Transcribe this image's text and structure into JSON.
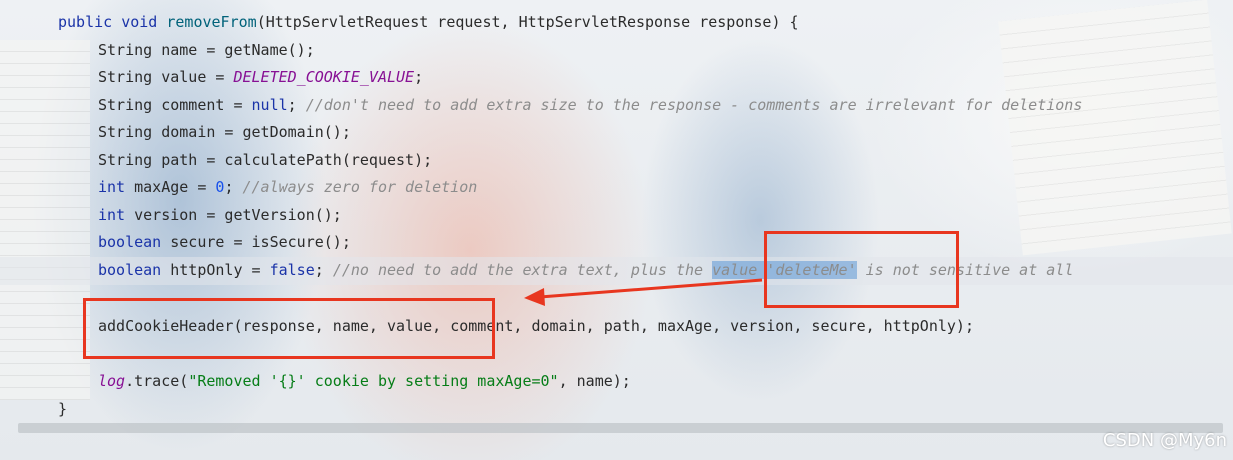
{
  "code": {
    "line1": {
      "kw1": "public",
      "kw2": "void",
      "method": "removeFrom",
      "rest": "(HttpServletRequest request, HttpServletResponse response) {"
    },
    "line2": {
      "text": "String name = getName();"
    },
    "line3": {
      "pre": "String value = ",
      "const": "DELETED_COOKIE_VALUE",
      "post": ";"
    },
    "line4": {
      "pre": "String comment = ",
      "kw": "null",
      "post": "; ",
      "comment": "//don't need to add extra size to the response - comments are irrelevant for deletions"
    },
    "line5": {
      "text": "String domain = getDomain();"
    },
    "line6": {
      "text": "String path = calculatePath(request);"
    },
    "line7": {
      "kw": "int",
      "pre": " maxAge = ",
      "num": "0",
      "post": "; ",
      "comment": "//always zero for deletion"
    },
    "line8": {
      "kw": "int",
      "rest": " version = getVersion();"
    },
    "line9": {
      "kw": "boolean",
      "rest": " secure = isSecure();"
    },
    "line10": {
      "kw": "boolean",
      "pre": " httpOnly = ",
      "kw2": "false",
      "post": "; ",
      "comment1": "//no need to add the extra text, plus the ",
      "selected": "value 'deleteMe'",
      "comment2": " is not sensitive at all"
    },
    "line11": {
      "text": "addCookieHeader(response, name, value, comment, domain, path, maxAge, version, secure, httpOnly);"
    },
    "line12": {
      "log": "log",
      "pre": ".trace(",
      "str": "\"Removed '{}' cookie by setting maxAge=0\"",
      "post": ", name);"
    },
    "line13": {
      "text": "}"
    }
  },
  "watermark": "CSDN @My6n",
  "colors": {
    "annotation": "#e8361f",
    "keyword": "#1a33a8",
    "comment": "#8c8c8c",
    "string": "#067d17"
  }
}
